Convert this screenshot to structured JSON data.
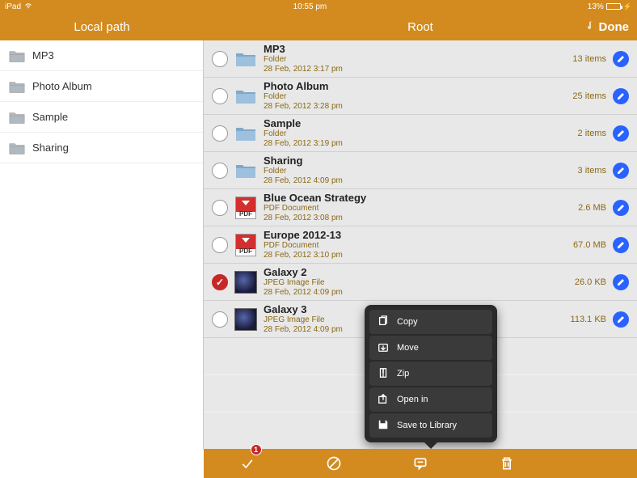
{
  "status": {
    "device": "iPad",
    "time": "10:55 pm",
    "battery": "13%"
  },
  "header": {
    "left_title": "Local path",
    "right_title": "Root",
    "done_label": "Done"
  },
  "sidebar": {
    "items": [
      {
        "label": "MP3"
      },
      {
        "label": "Photo Album"
      },
      {
        "label": "Sample"
      },
      {
        "label": "Sharing"
      }
    ]
  },
  "files": [
    {
      "name": "MP3",
      "type": "Folder",
      "date": "28 Feb, 2012 3:17 pm",
      "meta": "13 items",
      "icon": "folder",
      "checked": false
    },
    {
      "name": "Photo Album",
      "type": "Folder",
      "date": "28 Feb, 2012 3:28 pm",
      "meta": "25 items",
      "icon": "folder",
      "checked": false
    },
    {
      "name": "Sample",
      "type": "Folder",
      "date": "28 Feb, 2012 3:19 pm",
      "meta": "2 items",
      "icon": "folder",
      "checked": false
    },
    {
      "name": "Sharing",
      "type": "Folder",
      "date": "28 Feb, 2012 4:09 pm",
      "meta": "3 items",
      "icon": "folder",
      "checked": false
    },
    {
      "name": "Blue Ocean Strategy",
      "type": "PDF Document",
      "date": "28 Feb, 2012 3:08 pm",
      "meta": "2.6 MB",
      "icon": "pdf",
      "checked": false
    },
    {
      "name": "Europe 2012-13",
      "type": "PDF Document",
      "date": "28 Feb, 2012 3:10 pm",
      "meta": "67.0 MB",
      "icon": "pdf",
      "checked": false
    },
    {
      "name": "Galaxy 2",
      "type": "JPEG Image File",
      "date": "28 Feb, 2012 4:09 pm",
      "meta": "26.0 KB",
      "icon": "image",
      "checked": true
    },
    {
      "name": "Galaxy 3",
      "type": "JPEG Image File",
      "date": "28 Feb, 2012 4:09 pm",
      "meta": "113.1 KB",
      "icon": "image",
      "checked": false
    }
  ],
  "popup": {
    "items": [
      {
        "label": "Copy",
        "icon": "copy"
      },
      {
        "label": "Move",
        "icon": "move"
      },
      {
        "label": "Zip",
        "icon": "zip"
      },
      {
        "label": "Open in",
        "icon": "openin"
      },
      {
        "label": "Save to Library",
        "icon": "save"
      }
    ]
  },
  "toolbar": {
    "badge": "1"
  },
  "pdf_label": "PDF"
}
